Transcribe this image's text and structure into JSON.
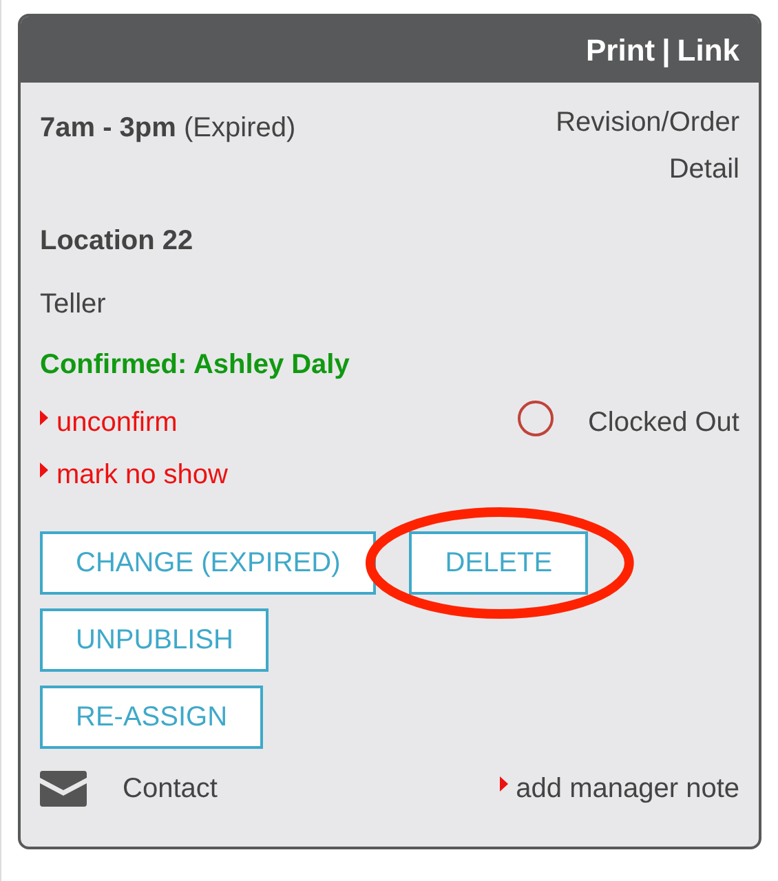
{
  "header": {
    "links": [
      {
        "label": "Print"
      },
      {
        "label": "Link"
      }
    ],
    "separator": "|"
  },
  "shift": {
    "time": "7am - 3pm",
    "status": "(Expired)",
    "detail_link": "Revision/Order Detail"
  },
  "location": "Location 22",
  "position": "Teller",
  "confirmed": "Confirmed: Ashley Daly",
  "action_links": [
    "unconfirm",
    "mark no show"
  ],
  "clock_status": "Clocked Out",
  "button_rows": [
    [
      {
        "label": "CHANGE (EXPIRED)",
        "circled": false
      },
      {
        "label": "DELETE",
        "circled": true
      }
    ],
    [
      {
        "label": "UNPUBLISH",
        "circled": false
      }
    ],
    [
      {
        "label": "RE-ASSIGN",
        "circled": false
      }
    ]
  ],
  "footer": {
    "contact": "Contact",
    "note_link": "add manager note"
  }
}
